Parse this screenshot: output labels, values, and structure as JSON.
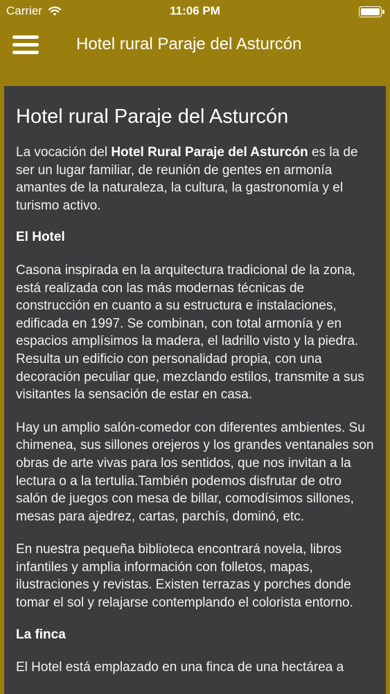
{
  "status_bar": {
    "carrier": "Carrier",
    "time": "11:06 PM"
  },
  "nav": {
    "title": "Hotel rural Paraje del Asturcón",
    "menu_icon": "hamburger-menu-icon"
  },
  "colors": {
    "nav_background": "#9b7f0e",
    "card_background": "#3c3b3d",
    "text": "#ffffff"
  },
  "content": {
    "title": "Hotel rural Paraje del Asturcón",
    "intro": {
      "before": "La vocación del ",
      "bold": "Hotel Rural Paraje del Asturcón",
      "after": " es la de ser un lugar familiar, de reunión de gentes en armonía amantes de la naturaleza, la cultura, la gastronomía y el turismo activo."
    },
    "heading_hotel": "El Hotel",
    "para_1": "Casona inspirada en la arquitectura tradicional de la zona, está realizada con las más modernas técnicas de construcción en cuanto a su estructura e instalaciones, edificada en 1997. Se combinan, con total armonía y en espacios amplísimos la madera, el ladrillo visto y la piedra. Resulta un edificio con personalidad propia, con una decoración peculiar que, mezclando estilos, transmite a sus visitantes la sensación de estar en casa.",
    "para_2": "Hay un amplio salón-comedor con diferentes ambientes. Su chimenea, sus sillones orejeros y los grandes ventanales son obras de arte vivas para los sentidos, que nos invitan a la lectura o a la tertulia.También podemos disfrutar de otro salón de juegos con mesa de billar, comodísimos sillones, mesas para ajedrez, cartas, parchís, dominó, etc.",
    "para_3": "En nuestra pequeña biblioteca encontrará novela, libros infantiles y amplia información con folletos, mapas, ilustraciones y revistas. Existen terrazas y porches donde tomar el sol y relajarse contemplando el colorista entorno.",
    "heading_finca": "La finca",
    "para_4": "El Hotel está emplazado en una finca de una hectárea a"
  }
}
